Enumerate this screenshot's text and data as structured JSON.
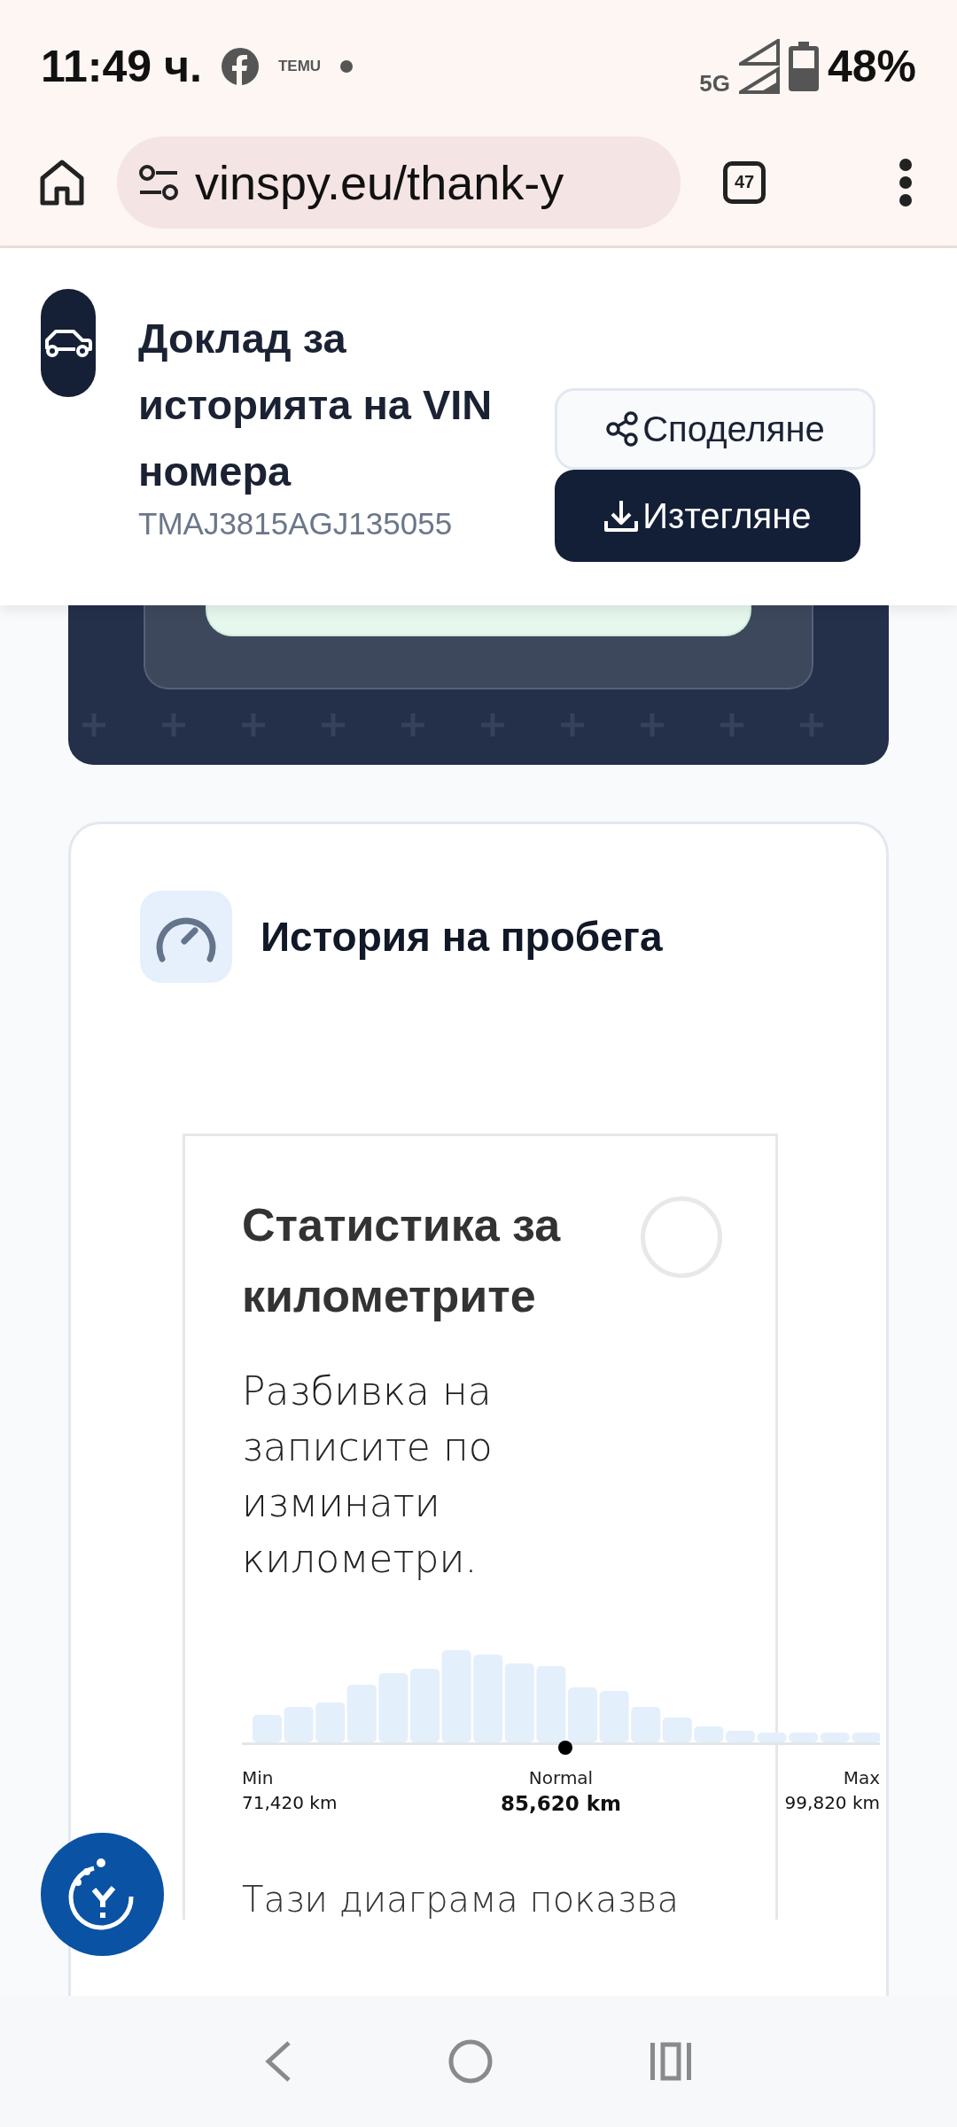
{
  "status_bar": {
    "time": "11:49 ч.",
    "notification_label": "TEMU",
    "network": "5G",
    "battery": "48%"
  },
  "browser": {
    "url": "vinspy.eu/thank-y",
    "tab_count": "47"
  },
  "report_header": {
    "title": "Доклад за историята на VIN номера",
    "vin": "TMAJ3815AGJ135055",
    "buttons": [
      {
        "kind": "share",
        "label": "Споделяне"
      },
      {
        "kind": "download",
        "label": "Изтегляне"
      }
    ]
  },
  "mileage_section": {
    "title": "История на пробега",
    "stats": {
      "title": "Статистика за километрите",
      "description": "Разбивка на записите по изминати километри.",
      "min_label": "Min",
      "min_value": "71,420 km",
      "normal_label": "Normal",
      "normal_value": "85,620 km",
      "max_label": "Max",
      "max_value": "99,820 km",
      "footer_text": "Тази диаграма показва"
    }
  }
}
